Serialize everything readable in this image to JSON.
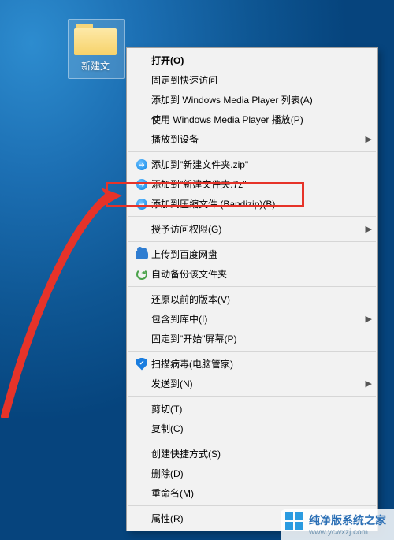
{
  "desktop": {
    "icon_label": "新建文"
  },
  "menu": {
    "open": "打开(O)",
    "pin_quick": "固定到快速访问",
    "wmp_list": "添加到 Windows Media Player 列表(A)",
    "wmp_play": "使用 Windows Media Player 播放(P)",
    "cast": "播放到设备",
    "bandi_zip": "添加到\"新建文件夹.zip\"",
    "bandi_7z": "添加到\"新建文件夹.7z\"",
    "bandi_add": "添加到压缩文件 (Bandizip)(B)...",
    "grant_access": "授予访问权限(G)",
    "baidu_upload": "上传到百度网盘",
    "baidu_backup": "自动备份该文件夹",
    "restore_prev": "还原以前的版本(V)",
    "include_lib": "包含到库中(I)",
    "pin_start": "固定到\"开始\"屏幕(P)",
    "scan_virus": "扫描病毒(电脑管家)",
    "send_to": "发送到(N)",
    "cut": "剪切(T)",
    "copy": "复制(C)",
    "shortcut": "创建快捷方式(S)",
    "delete": "删除(D)",
    "rename": "重命名(M)",
    "properties": "属性(R)"
  },
  "watermark": {
    "text": "纯净版系统之家",
    "domain": "www.ycwxzj.com"
  }
}
